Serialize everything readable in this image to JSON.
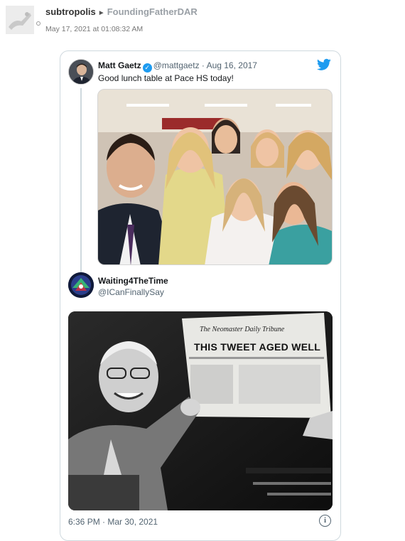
{
  "post": {
    "user": "subtropolis",
    "arrow": "►",
    "recipient": "FoundingFatherDAR",
    "date": "May 17, 2021 at 01:08:32 AM"
  },
  "quoted_tweet": {
    "name": "Matt Gaetz",
    "handle": "@mattgaetz",
    "date": "· Aug 16, 2017",
    "text": "Good lunch table at Pace HS today!"
  },
  "reply_tweet": {
    "name": "Waiting4TheTime",
    "handle": "@ICanFinallySay",
    "newspaper_masthead": "The Neomaster Daily Tribune",
    "newspaper_headline": "THIS TWEET AGED WELL",
    "timestamp": "6:36 PM · Mar 30, 2021"
  },
  "icons": {
    "bird": "twitter-bird-icon",
    "verified": "verified-badge-icon",
    "info": "info-icon"
  },
  "colors": {
    "twitter_blue": "#1d9bf0",
    "border": "#cfd9de",
    "muted": "#536471"
  }
}
